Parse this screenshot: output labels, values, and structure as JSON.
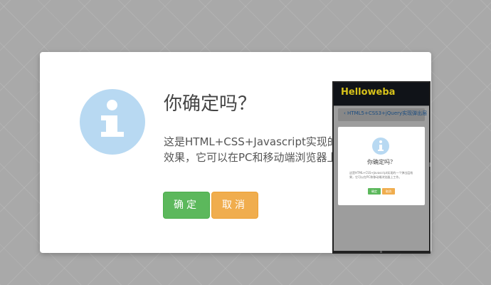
{
  "dialog": {
    "title": "你确定吗？",
    "body_line1": "这是HTML+CSS+Javascript实现的",
    "body_line2": "效果，它可以在PC和移动端浏览器上",
    "confirm_label": "确定",
    "cancel_label": "取消",
    "icon": "info-icon"
  },
  "phone_preview": {
    "logo": "Helloweba",
    "breadcrumb": "HTML5+CSS3+jQuery实现弹出层",
    "dialog_title": "你确定吗？",
    "dialog_text": "这是HTML+CSS+Javascript实现的一个弹出层效果，它可以在PC和移动端浏览器上工作。",
    "confirm_label": "确定",
    "cancel_label": "取消"
  },
  "colors": {
    "confirm": "#5cb85c",
    "cancel": "#f0ad4e",
    "info_icon": "#b8d9f2",
    "backdrop": "#a9a9a9"
  }
}
